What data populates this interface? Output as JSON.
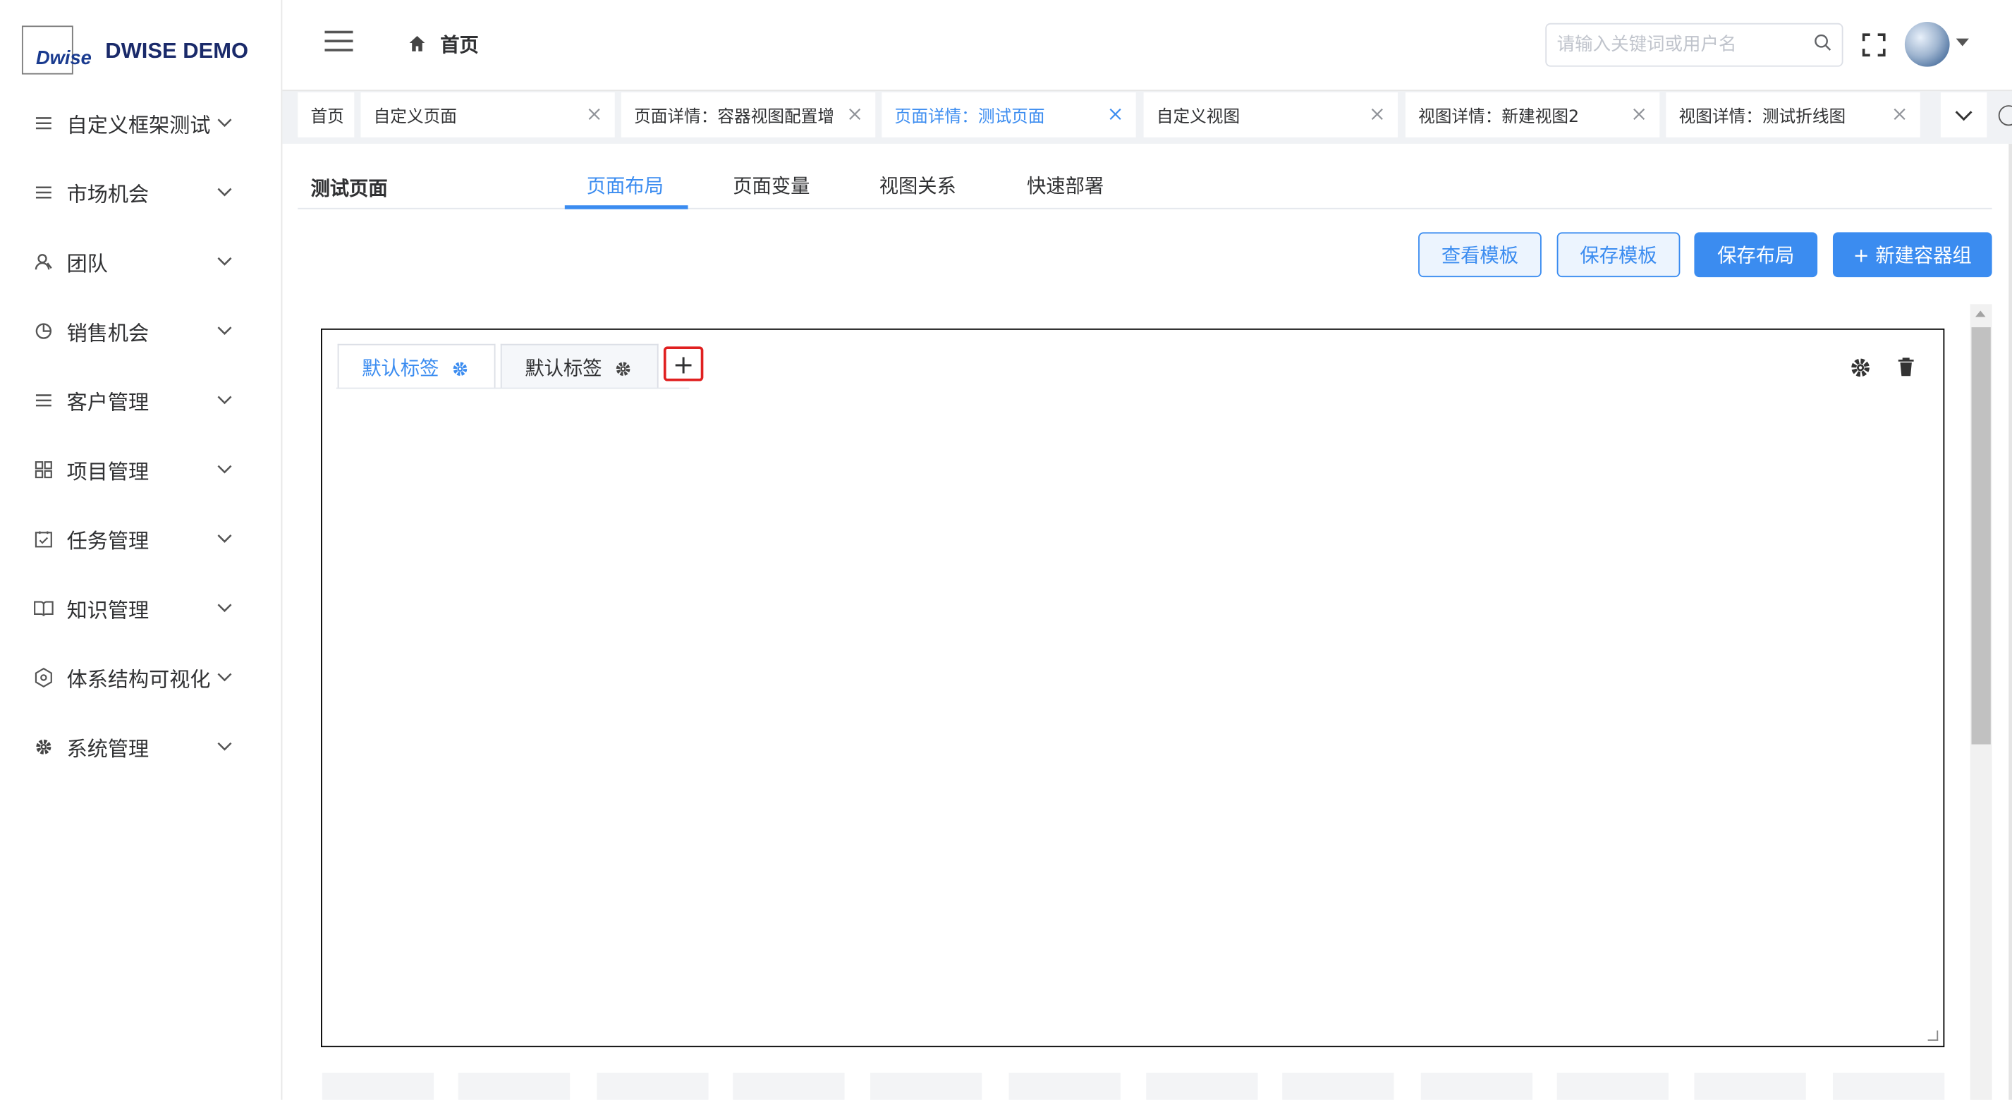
{
  "brand": {
    "logo_text": "Dwise",
    "name": "DWISE DEMO"
  },
  "sidebar": {
    "items": [
      {
        "label": "自定义框架测试",
        "icon": "list-icon"
      },
      {
        "label": "市场机会",
        "icon": "list-icon"
      },
      {
        "label": "团队",
        "icon": "user-icon"
      },
      {
        "label": "销售机会",
        "icon": "pie-icon"
      },
      {
        "label": "客户管理",
        "icon": "list-icon"
      },
      {
        "label": "项目管理",
        "icon": "grid-icon"
      },
      {
        "label": "任务管理",
        "icon": "calendar-check-icon"
      },
      {
        "label": "知识管理",
        "icon": "book-icon"
      },
      {
        "label": "体系结构可视化",
        "icon": "hexagon-icon"
      },
      {
        "label": "系统管理",
        "icon": "gear-icon"
      }
    ]
  },
  "header": {
    "breadcrumb": "首页",
    "search_placeholder": "请输入关键词或用户名"
  },
  "page_tabs": [
    {
      "label": "首页",
      "closable": false,
      "active": false
    },
    {
      "label": "自定义页面",
      "closable": true,
      "active": false
    },
    {
      "label": "页面详情：容器视图配置增",
      "closable": true,
      "active": false
    },
    {
      "label": "页面详情：测试页面",
      "closable": true,
      "active": true
    },
    {
      "label": "自定义视图",
      "closable": true,
      "active": false
    },
    {
      "label": "视图详情：新建视图2",
      "closable": true,
      "active": false
    },
    {
      "label": "视图详情：测试折线图",
      "closable": true,
      "active": false
    }
  ],
  "page": {
    "title": "测试页面",
    "sub_tabs": [
      "页面布局",
      "页面变量",
      "视图关系",
      "快速部署"
    ],
    "buttons": {
      "view_template": "查看模板",
      "save_template": "保存模板",
      "save_layout": "保存布局",
      "new_container_group": "+ 新建容器组"
    },
    "container_tabs": [
      "默认标签",
      "默认标签"
    ],
    "add_tab_symbol": "+"
  },
  "colors": {
    "accent": "#3b8cf0",
    "highlight_border": "#e02020"
  }
}
